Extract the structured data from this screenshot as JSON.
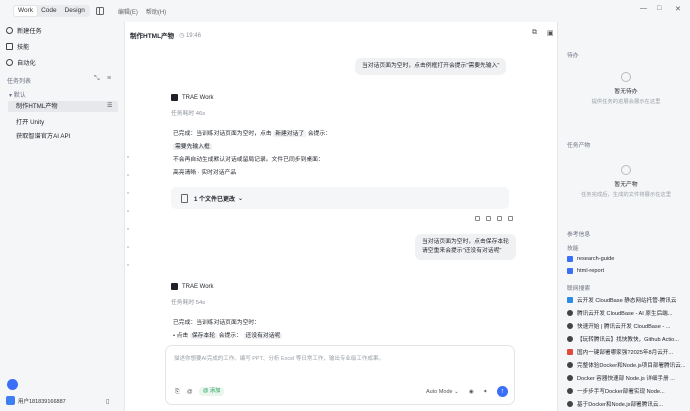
{
  "topbar": {
    "modes": [
      "Work",
      "Code",
      "Design"
    ],
    "active_mode": "Work",
    "menus": [
      "编辑(E)",
      "帮助(H)"
    ],
    "window_controls": [
      "—",
      "□",
      "✕"
    ]
  },
  "sidebar": {
    "nav": [
      {
        "label": "新建任务",
        "icon": "new-task-icon"
      },
      {
        "label": "技能",
        "icon": "skills-icon"
      },
      {
        "label": "自动化",
        "icon": "automation-icon"
      }
    ],
    "task_list_label": "任务列表",
    "group_label": "默认",
    "tasks": [
      "制作HTML产物",
      "打开 Unity",
      "获取智谱官方AI API"
    ],
    "user": "用户181839166887"
  },
  "main": {
    "title": "制作HTML产物",
    "time": "19:46",
    "user_msg_1": "当对话页面为空时，点击例框打开会提示\"需要先输入\"",
    "agent_name": "TRAE Work",
    "duration_1": "任务耗时 46s",
    "reply_line1_pre": "已完成：当训练对话页面为空时，点击",
    "reply_line1_tag": "新建对话了",
    "reply_line1_post": "会提示：",
    "reply_line2_tag": "需要先输入框",
    "reply_line3": "不会再自动生成默认对话或留局记录。文件已同步到桌面：",
    "reply_line4": "高亮清晰 · 实时对话产品",
    "file_summary": "1 个文件已更改",
    "user_msg_2_line1": "当对话页面为空时，点击保存本轮",
    "user_msg_2_line2": "请空重来会提示\"还没有对话呢\"",
    "duration_2": "任务耗时 54s",
    "reply2_line1": "已完成：当训练对话页面为空时：",
    "reply2_line2_pre": "• 点击",
    "reply2_line2_tag": "保存本轮",
    "reply2_line2_mid": "会提示：",
    "reply2_line2_tag2": "还没有对话呢",
    "input_placeholder": "描述你想要AI完成的工作。编写 PPT、分析 Excel 等日常工作，输出专业级工作成果。",
    "pill": "@ 添加",
    "mode_select": "Auto Mode"
  },
  "rpanel": {
    "todo_label": "待办",
    "todo_empty": "暂无待办",
    "todo_hint": "提供任务的进展会展示在这里",
    "output_label": "任务产物",
    "output_empty": "暂无产物",
    "output_hint": "任务完成后，生成的文件将展示在这里",
    "ref_label": "参考信息",
    "skills_label": "技能",
    "skills": [
      "research-guide",
      "html-report"
    ],
    "search_label": "联网搜索",
    "results": [
      "云开发 CloudBase 静态网站托管-腾讯云",
      "腾讯云开发 CloudBase - AI 原生后端...",
      "快速开始 | 腾讯云开发 CloudBase - ...",
      "【玩转腾讯云】找快教快，Github Actio...",
      "国内一键部署哪家强?2025年8月云开...",
      "完整体验Docker和Node.js项目部署腾讯云...",
      "Docker 容器快速部 Node.js 详细手册 ...",
      "一步步手写Docker部署实现 Node...",
      "基于Docker和Node.js部署腾讯云..."
    ]
  },
  "colors": {
    "accent": "#3a6ff7",
    "green": "#1f9d55"
  }
}
